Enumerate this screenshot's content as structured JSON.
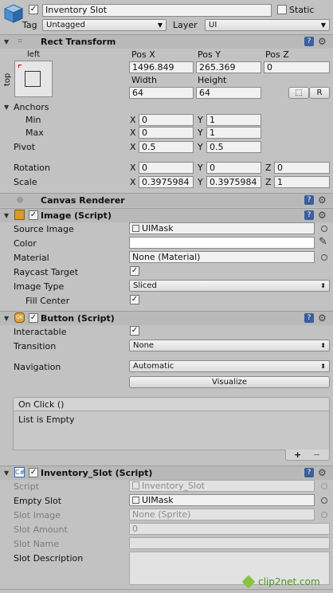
{
  "top": {
    "name": "Inventory Slot",
    "static_label": "Static",
    "tag_label": "Tag",
    "tag_value": "Untagged",
    "layer_label": "Layer",
    "layer_value": "UI"
  },
  "rect": {
    "title": "Rect Transform",
    "anchor_h": "left",
    "anchor_v": "top",
    "posx_label": "Pos X",
    "posy_label": "Pos Y",
    "posz_label": "Pos Z",
    "posx": "1496.849",
    "posy": "265.369",
    "posz": "0",
    "width_label": "Width",
    "height_label": "Height",
    "width": "64",
    "height": "64",
    "r_button": "R",
    "anchors_label": "Anchors",
    "min_label": "Min",
    "max_label": "Max",
    "min_x": "0",
    "min_y": "1",
    "max_x": "0",
    "max_y": "1",
    "pivot_label": "Pivot",
    "pivot_x": "0.5",
    "pivot_y": "0.5",
    "rotation_label": "Rotation",
    "rot_x": "0",
    "rot_y": "0",
    "rot_z": "0",
    "scale_label": "Scale",
    "scale_x": "0.3975984",
    "scale_y": "0.3975984",
    "scale_z": "1",
    "x": "X",
    "y": "Y",
    "z": "Z"
  },
  "canvas_renderer": {
    "title": "Canvas Renderer"
  },
  "image": {
    "title": "Image (Script)",
    "source_label": "Source Image",
    "source_value": "UIMask",
    "color_label": "Color",
    "material_label": "Material",
    "material_value": "None (Material)",
    "raycast_label": "Raycast Target",
    "type_label": "Image Type",
    "type_value": "Sliced",
    "fill_label": "Fill Center"
  },
  "button": {
    "title": "Button (Script)",
    "interactable_label": "Interactable",
    "transition_label": "Transition",
    "transition_value": "None",
    "navigation_label": "Navigation",
    "navigation_value": "Automatic",
    "visualize": "Visualize",
    "onclick_label": "On Click ()",
    "list_empty": "List is Empty",
    "plus": "+",
    "minus": "−"
  },
  "slot": {
    "title": "Inventory_Slot (Script)",
    "script_label": "Script",
    "script_value": "Inventory_Slot",
    "empty_label": "Empty Slot",
    "empty_value": "UIMask",
    "image_label": "Slot Image",
    "image_value": "None (Sprite)",
    "amount_label": "Slot Amount",
    "amount_value": "0",
    "name_label": "Slot Name",
    "name_value": "",
    "desc_label": "Slot Description",
    "desc_value": ""
  },
  "watermark": "clip2net.com"
}
